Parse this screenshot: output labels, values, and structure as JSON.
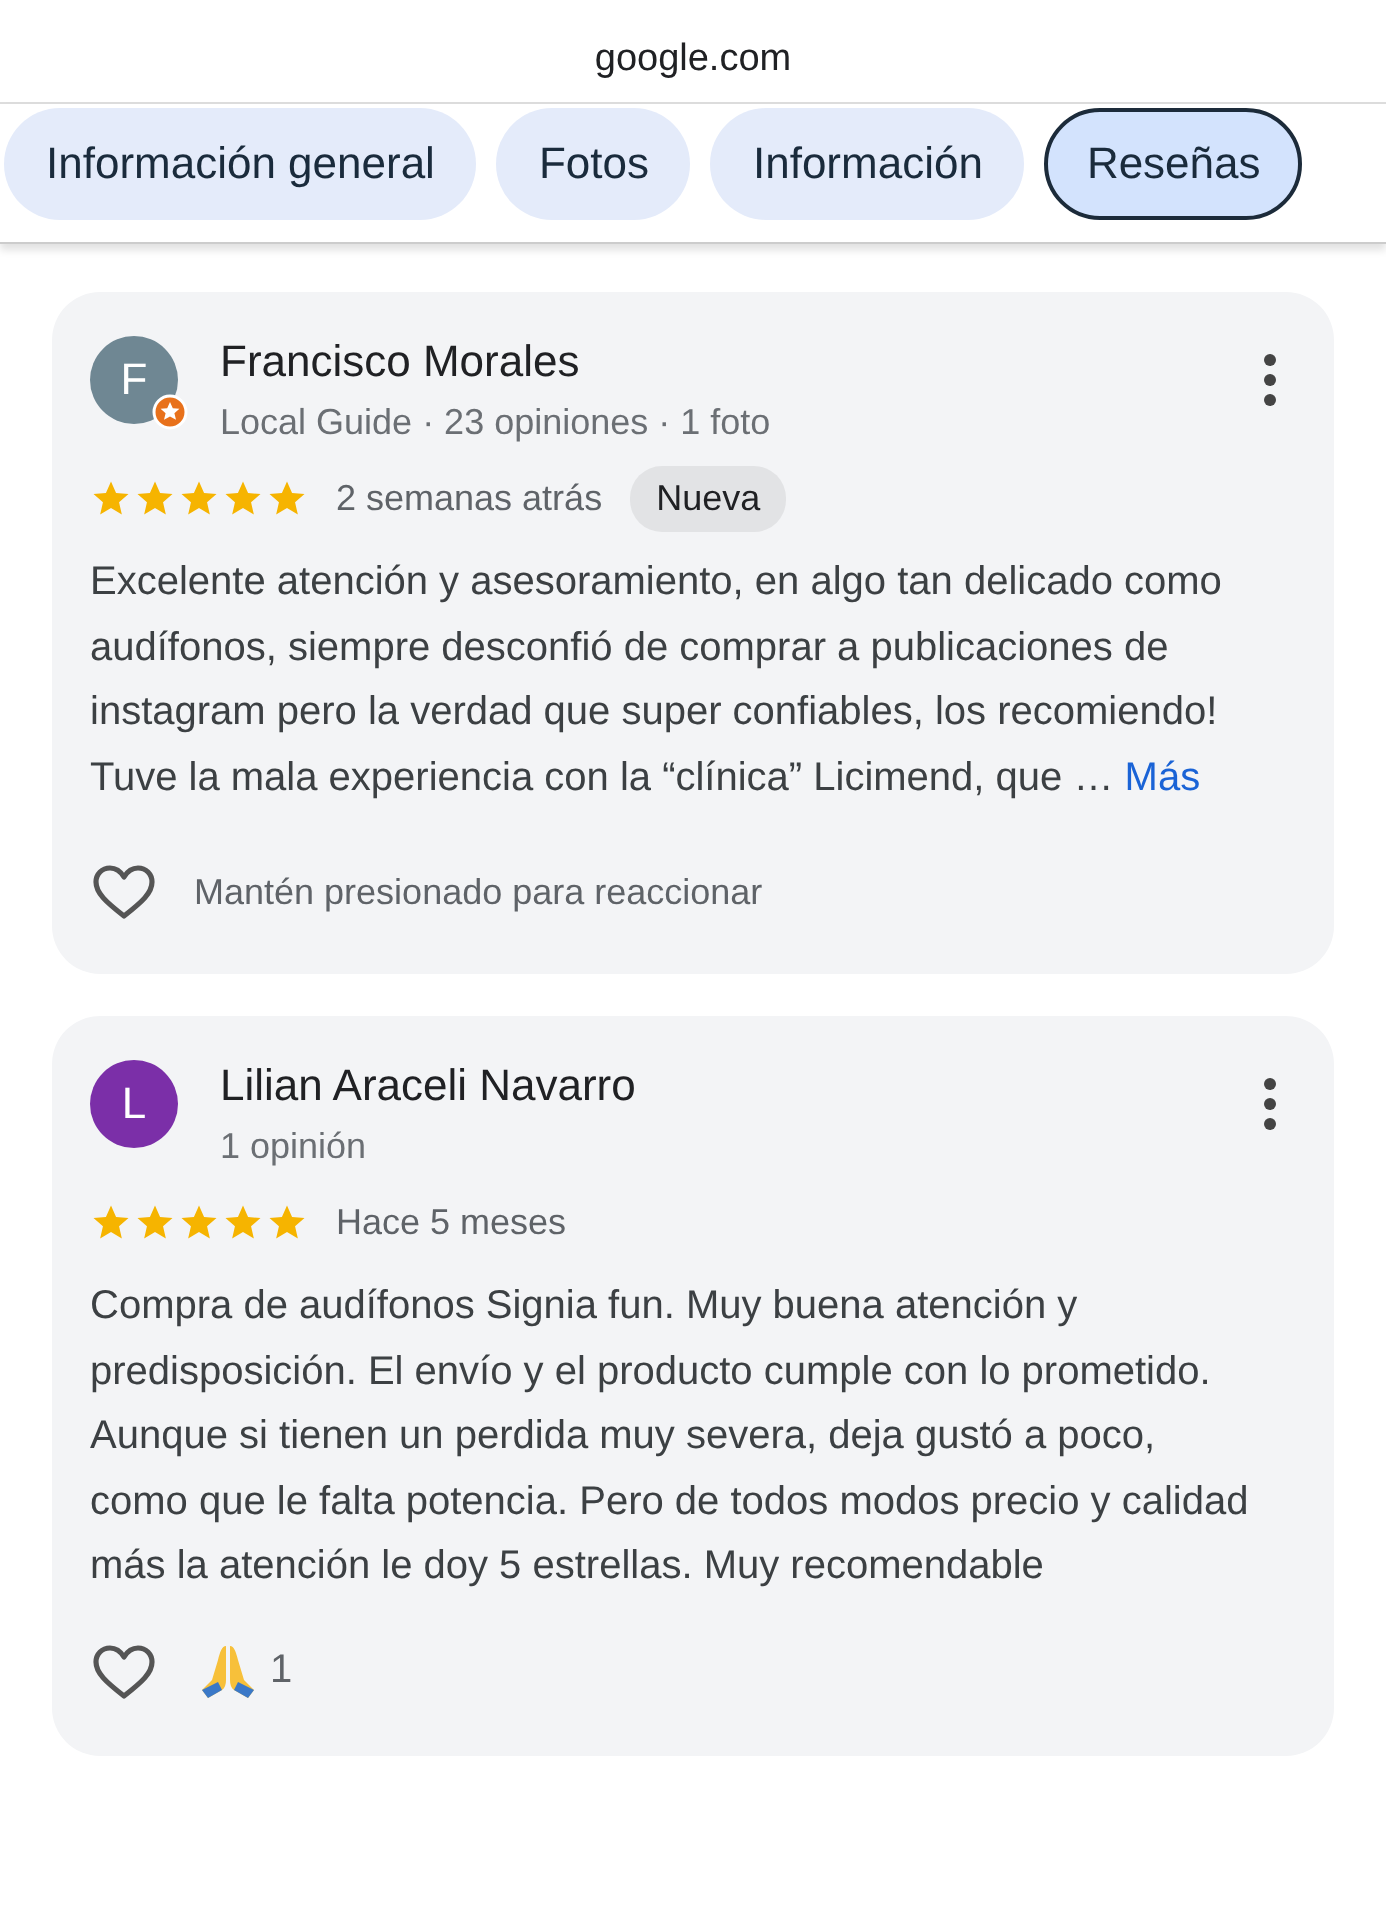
{
  "address": "google.com",
  "tabs": [
    {
      "label": "Información general",
      "selected": false
    },
    {
      "label": "Fotos",
      "selected": false
    },
    {
      "label": "Información",
      "selected": false
    },
    {
      "label": "Reseñas",
      "selected": true
    }
  ],
  "reviews": [
    {
      "avatar_letter": "F",
      "color": "#6f8793",
      "local_guide": true,
      "name": "Francisco Morales",
      "meta": "Local Guide · 23 opiniones · 1 foto",
      "stars": 5,
      "time": "2 semanas atrás",
      "badge": "Nueva",
      "text": "Excelente atención y asesoramiento, en algo tan delicado como audífonos, siempre desconfió de comprar a publicaciones de instagram pero la verdad que super confiables, los recomiendo! Tuve la mala experiencia con la “clínica” Licimend, que …",
      "more": "Más",
      "reaction_hint": "Mantén presionado para reaccionar"
    },
    {
      "avatar_letter": "L",
      "color": "#7b2fa8",
      "local_guide": false,
      "name": "Lilian Araceli Navarro",
      "meta": "1 opinión",
      "stars": 5,
      "time": "Hace 5 meses",
      "text": "Compra de audífonos Signia fun. Muy buena atención y predisposición. El envío y el producto cumple con lo prometido. Aunque si tienen un perdida muy severa, deja gustó a poco, como que le falta potencia. Pero de todos modos precio y calidad más la atención le doy 5 estrellas. Muy recomendable",
      "reaction_count": "1"
    }
  ]
}
